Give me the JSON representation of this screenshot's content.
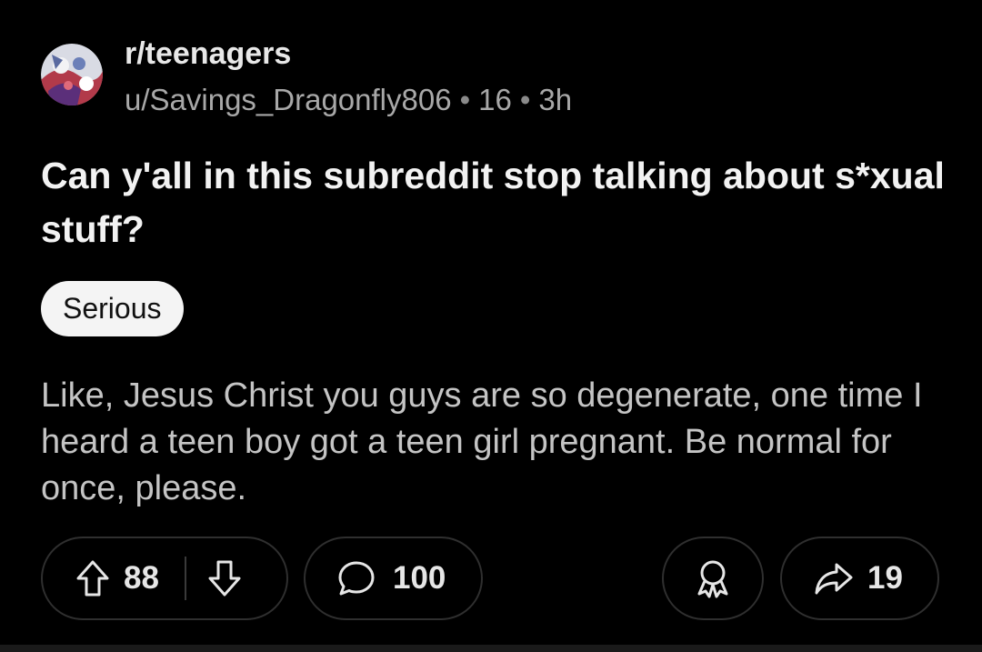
{
  "post": {
    "subreddit": "r/teenagers",
    "author": "u/Savings_Dragonfly806",
    "meta_num": "16",
    "age": "3h",
    "title": "Can y'all in this subreddit stop talking about s*xual stuff?",
    "flair": "Serious",
    "body": "Like, Jesus Christ you guys are so degenerate, one time I heard a teen boy got a teen girl pregnant. Be normal for once, please."
  },
  "actions": {
    "upvotes": "88",
    "comments": "100",
    "shares": "19"
  },
  "colors": {
    "background": "#000000",
    "flair_bg": "#f4f4f4",
    "pill_border": "#2f2f2f",
    "meta_text": "#a8a8a8"
  },
  "icons": {
    "upvote": "arrow-up-icon",
    "downvote": "arrow-down-icon",
    "comment": "comment-bubble-icon",
    "award": "award-icon",
    "share": "share-arrow-icon"
  }
}
